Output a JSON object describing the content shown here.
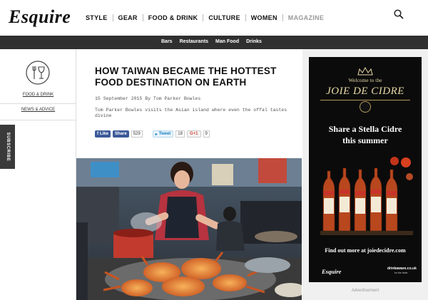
{
  "header": {
    "logo": "Esquire",
    "nav": [
      "STYLE",
      "GEAR",
      "FOOD & DRINK",
      "CULTURE",
      "WOMEN",
      "MAGAZINE"
    ]
  },
  "subnav": [
    "Bars",
    "Restaurants",
    "Man Food",
    "Drinks"
  ],
  "sidebar": {
    "section_label": "FOOD & DRINK",
    "news_label": "NEWS & ADVICE",
    "subscribe_label": "SUBSCRIBE"
  },
  "article": {
    "headline": "HOW TAIWAN BECAME THE HOTTEST FOOD DESTINATION ON EARTH",
    "byline": "15 September 2015 By Tom Parker Bowles",
    "standfirst": "Tom Parker Bowles visits the Asian island where even the offal tastes divine",
    "social": {
      "like": "Like",
      "share": "Share",
      "share_count": "529",
      "tweet": "Tweet",
      "tweet_count": "18",
      "gplus": "G+1",
      "gplus_count": "9"
    }
  },
  "ad": {
    "welcome": "Welcome to the",
    "title": "JOIE DE CIDRE",
    "head1": "Share a Stella Cidre",
    "head2": "this summer",
    "cta": "Find out more at joiedecidre.com",
    "brand": "Esquire",
    "drinkaware": "drinkaware.co.uk",
    "drinkaware_sub": "for the facts",
    "label": "Advertisement"
  }
}
